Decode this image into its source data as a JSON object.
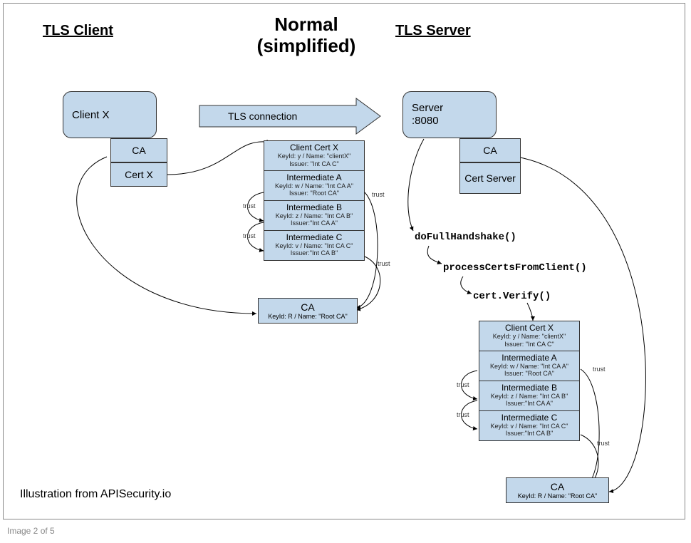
{
  "headers": {
    "client": "TLS Client",
    "main_line1": "Normal",
    "main_line2": "(simplified)",
    "server": "TLS Server"
  },
  "client": {
    "name": "Client X",
    "ca_label": "CA",
    "cert_label": "Cert X"
  },
  "conn_label": "TLS connection",
  "server": {
    "name_line1": "Server",
    "name_line2": ":8080",
    "ca_label": "CA",
    "cert_label": "Cert Server"
  },
  "chain_left": {
    "c0_t": "Client Cert X",
    "c0_s1": "KeyId: y / Name: \"clientX\"",
    "c0_s2": "Issuer: \"Int CA C\"",
    "c1_t": "Intermediate A",
    "c1_s1": "KeyId: w / Name: \"Int CA A\"",
    "c1_s2": "Issuer: \"Root CA\"",
    "c2_t": "Intermediate B",
    "c2_s1": "KeyId: z / Name: \"Int CA B\"",
    "c2_s2": "Issuer:\"Int CA A\"",
    "c3_t": "Intermediate C",
    "c3_s1": "KeyId: v / Name: \"Int CA C\"",
    "c3_s2": "Issuer:\"Int CA B\""
  },
  "ca_left": {
    "t": "CA",
    "s": "KeyId: R / Name: \"Root CA\""
  },
  "funcs": {
    "f1": "doFullHandshake()",
    "f2": "processCertsFromClient()",
    "f3": "cert.Verify()"
  },
  "chain_right": {
    "c0_t": "Client Cert X",
    "c0_s1": "KeyId: y / Name: \"clientX\"",
    "c0_s2": "Issuer: \"Int CA C\"",
    "c1_t": "Intermediate A",
    "c1_s1": "KeyId: w / Name: \"Int CA A\"",
    "c1_s2": "Issuer: \"Root CA\"",
    "c2_t": "Intermediate B",
    "c2_s1": "KeyId: z / Name: \"Int CA B\"",
    "c2_s2": "Issuer:\"Int CA A\"",
    "c3_t": "Intermediate C",
    "c3_s1": "KeyId: v / Name: \"Int CA C\"",
    "c3_s2": "Issuer:\"Int CA B\""
  },
  "ca_right": {
    "t": "CA",
    "s": "KeyId: R / Name: \"Root CA\""
  },
  "trust_label": "trust",
  "attribution": "Illustration from APISecurity.io",
  "footer": "Image 2 of 5"
}
